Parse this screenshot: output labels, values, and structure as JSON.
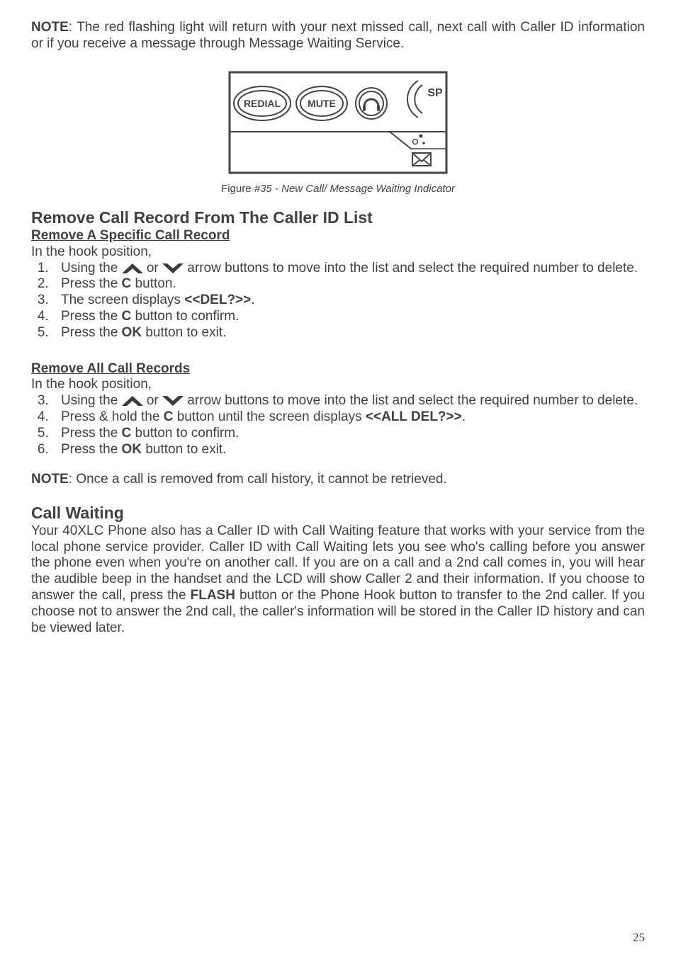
{
  "note1": {
    "label": "NOTE",
    "text": ": The red flashing light will return with your next missed call, next call with Caller ID information or if you receive a message through Message Waiting Service."
  },
  "figure": {
    "redial": "REDIAL",
    "mute": "MUTE",
    "sp": "SP",
    "caption_prefix": "Figure ",
    "caption_italic": "#35 - New Call/ Message Waiting Indicator"
  },
  "section1": {
    "title": "Remove Call Record From The Caller ID List",
    "sub1": "Remove A Specific Call Record",
    "lead": "In the hook position,",
    "step1a": "Using the ",
    "step1_or": " or ",
    "step1b": " arrow buttons to move into the list and select the required number to delete.",
    "step2a": "Press the ",
    "step2b": "C",
    "step2c": " button.",
    "step3a": "The screen displays ",
    "step3b": "<<DEL?>>",
    "step3c": ".",
    "step4a": "Press the ",
    "step4b": "C",
    "step4c": " button to confirm.",
    "step5a": "Press the ",
    "step5b": "OK",
    "step5c": " button to exit."
  },
  "section2": {
    "sub": "Remove All Call Records ",
    "lead": "In the hook position,",
    "step3a": "Using the ",
    "step3_or": " or ",
    "step3b": " arrow buttons to move into the list and select the required number to delete.",
    "step4a": "Press  & hold the ",
    "step4b": "C",
    "step4c": " button until the screen displays ",
    "step4d": "<<ALL DEL?>>",
    "step4e": ".",
    "step5a": "Press the ",
    "step5b": "C",
    "step5c": " button to confirm.",
    "step6a": "Press the ",
    "step6b": "OK",
    "step6c": " button to exit."
  },
  "note2": {
    "label": "NOTE",
    "text": ": Once a call is removed from call history, it cannot be retrieved."
  },
  "callwaiting": {
    "title": "Call Waiting",
    "body1": "Your 40XLC Phone also has a Caller ID with Call Waiting feature that works with your service from the local phone service provider. Caller ID with Call Waiting lets you see who's calling before you answer the phone even when you're on another call. If you are on a call and a 2nd call comes in, you will hear the audible beep in the handset and the LCD will show Caller 2 and their information.  If you choose to answer the call, press the ",
    "flash": "FLASH",
    "body2": " button or the Phone Hook button to transfer to the 2nd caller. If you choose not to answer the 2nd call, the caller's information will be stored in the Caller ID history and can be viewed later."
  },
  "page_number": "25"
}
